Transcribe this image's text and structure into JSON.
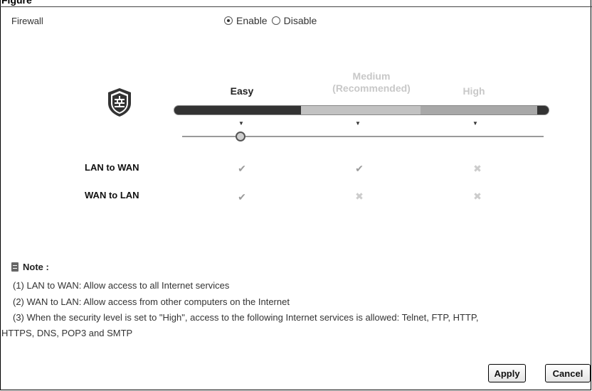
{
  "figure_caption_partial": "Figure",
  "firewall": {
    "label": "Firewall",
    "enable_label": "Enable",
    "disable_label": "Disable",
    "selected": "Enable"
  },
  "levels": {
    "easy": "Easy",
    "medium_line1": "Medium",
    "medium_line2": "(Recommended)",
    "high": "High",
    "selected": "Easy"
  },
  "rows": [
    {
      "label": "LAN to WAN",
      "easy": "check",
      "medium": "check",
      "high": "cross"
    },
    {
      "label": "WAN to LAN",
      "easy": "check",
      "medium": "cross",
      "high": "cross"
    }
  ],
  "note": {
    "title": "Note :",
    "line1": "(1) LAN to WAN: Allow access to all Internet services",
    "line2": "(2) WAN to LAN: Allow access from other computers on the Internet",
    "line3": "(3) When the security level is set to \"High\", access to the following Internet services is allowed: Telnet, FTP, HTTP,",
    "line4": "HTTPS, DNS, POP3 and SMTP"
  },
  "buttons": {
    "apply": "Apply",
    "cancel": "Cancel"
  },
  "colors": {
    "bar_dark": "#333333",
    "bar_light": "#c2c2c2",
    "inactive_label": "#c8c8c8"
  }
}
